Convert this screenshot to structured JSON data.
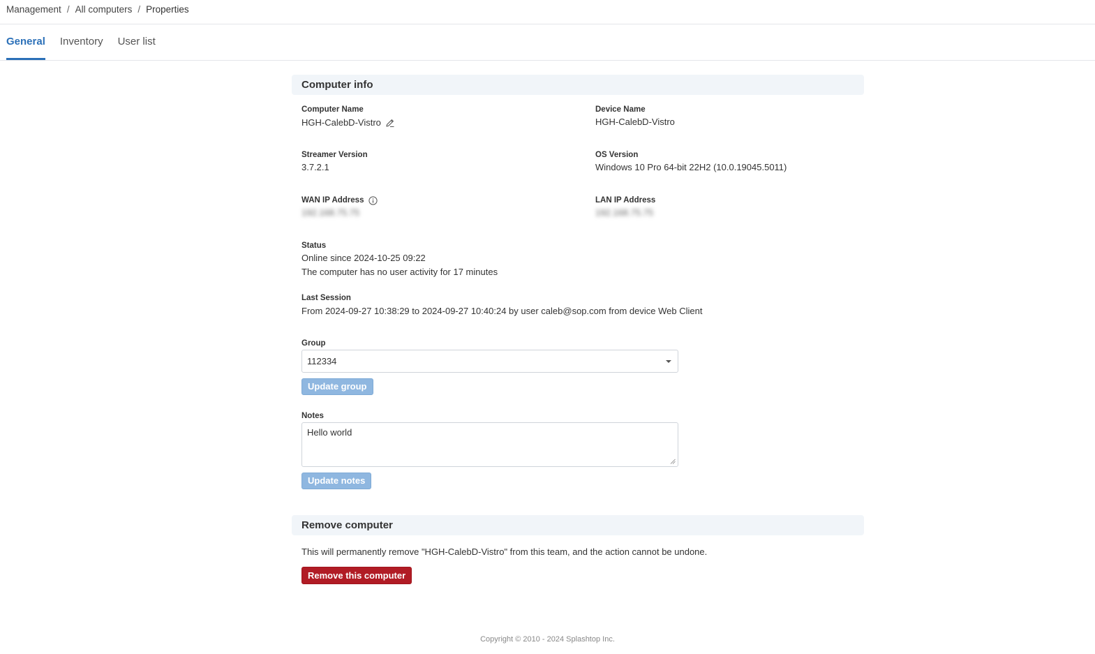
{
  "breadcrumb": {
    "items": [
      "Management",
      "All computers",
      "Properties"
    ],
    "separator": "/"
  },
  "tabs": [
    {
      "label": "General",
      "active": true
    },
    {
      "label": "Inventory",
      "active": false
    },
    {
      "label": "User list",
      "active": false
    }
  ],
  "computer_info": {
    "title": "Computer info",
    "computer_name": {
      "label": "Computer Name",
      "value": "HGH-CalebD-Vistro",
      "icon": "pencil-icon"
    },
    "device_name": {
      "label": "Device Name",
      "value": "HGH-CalebD-Vistro"
    },
    "streamer_version": {
      "label": "Streamer Version",
      "value": "3.7.2.1"
    },
    "os_version": {
      "label": "OS Version",
      "value": "Windows 10 Pro 64-bit 22H2 (10.0.19045.5011)"
    },
    "wan_ip": {
      "label": "WAN IP Address",
      "value": "192.168.75.75",
      "icon": "info-icon"
    },
    "lan_ip": {
      "label": "LAN IP Address",
      "value": "192.168.75.75"
    },
    "status": {
      "label": "Status",
      "line1": "Online since 2024-10-25 09:22",
      "line2": "The computer has no user activity for 17 minutes"
    },
    "last_session": {
      "label": "Last Session",
      "value": "From 2024-09-27 10:38:29 to 2024-09-27 10:40:24 by user caleb@sop.com from device Web Client"
    },
    "group": {
      "label": "Group",
      "selected": "112334",
      "button": "Update group"
    },
    "notes": {
      "label": "Notes",
      "value": "Hello world",
      "button": "Update notes"
    }
  },
  "remove_computer": {
    "title": "Remove computer",
    "description": "This will permanently remove \"HGH-CalebD-Vistro\" from this team, and the action cannot be undone.",
    "button": "Remove this computer"
  },
  "footer": {
    "copyright": "Copyright © 2010 - 2024 Splashtop Inc."
  },
  "colors": {
    "accent": "#2b70b8",
    "danger": "#b11c25",
    "disabled_button": "#8fb7e0",
    "section_bg": "#f1f5f9"
  }
}
